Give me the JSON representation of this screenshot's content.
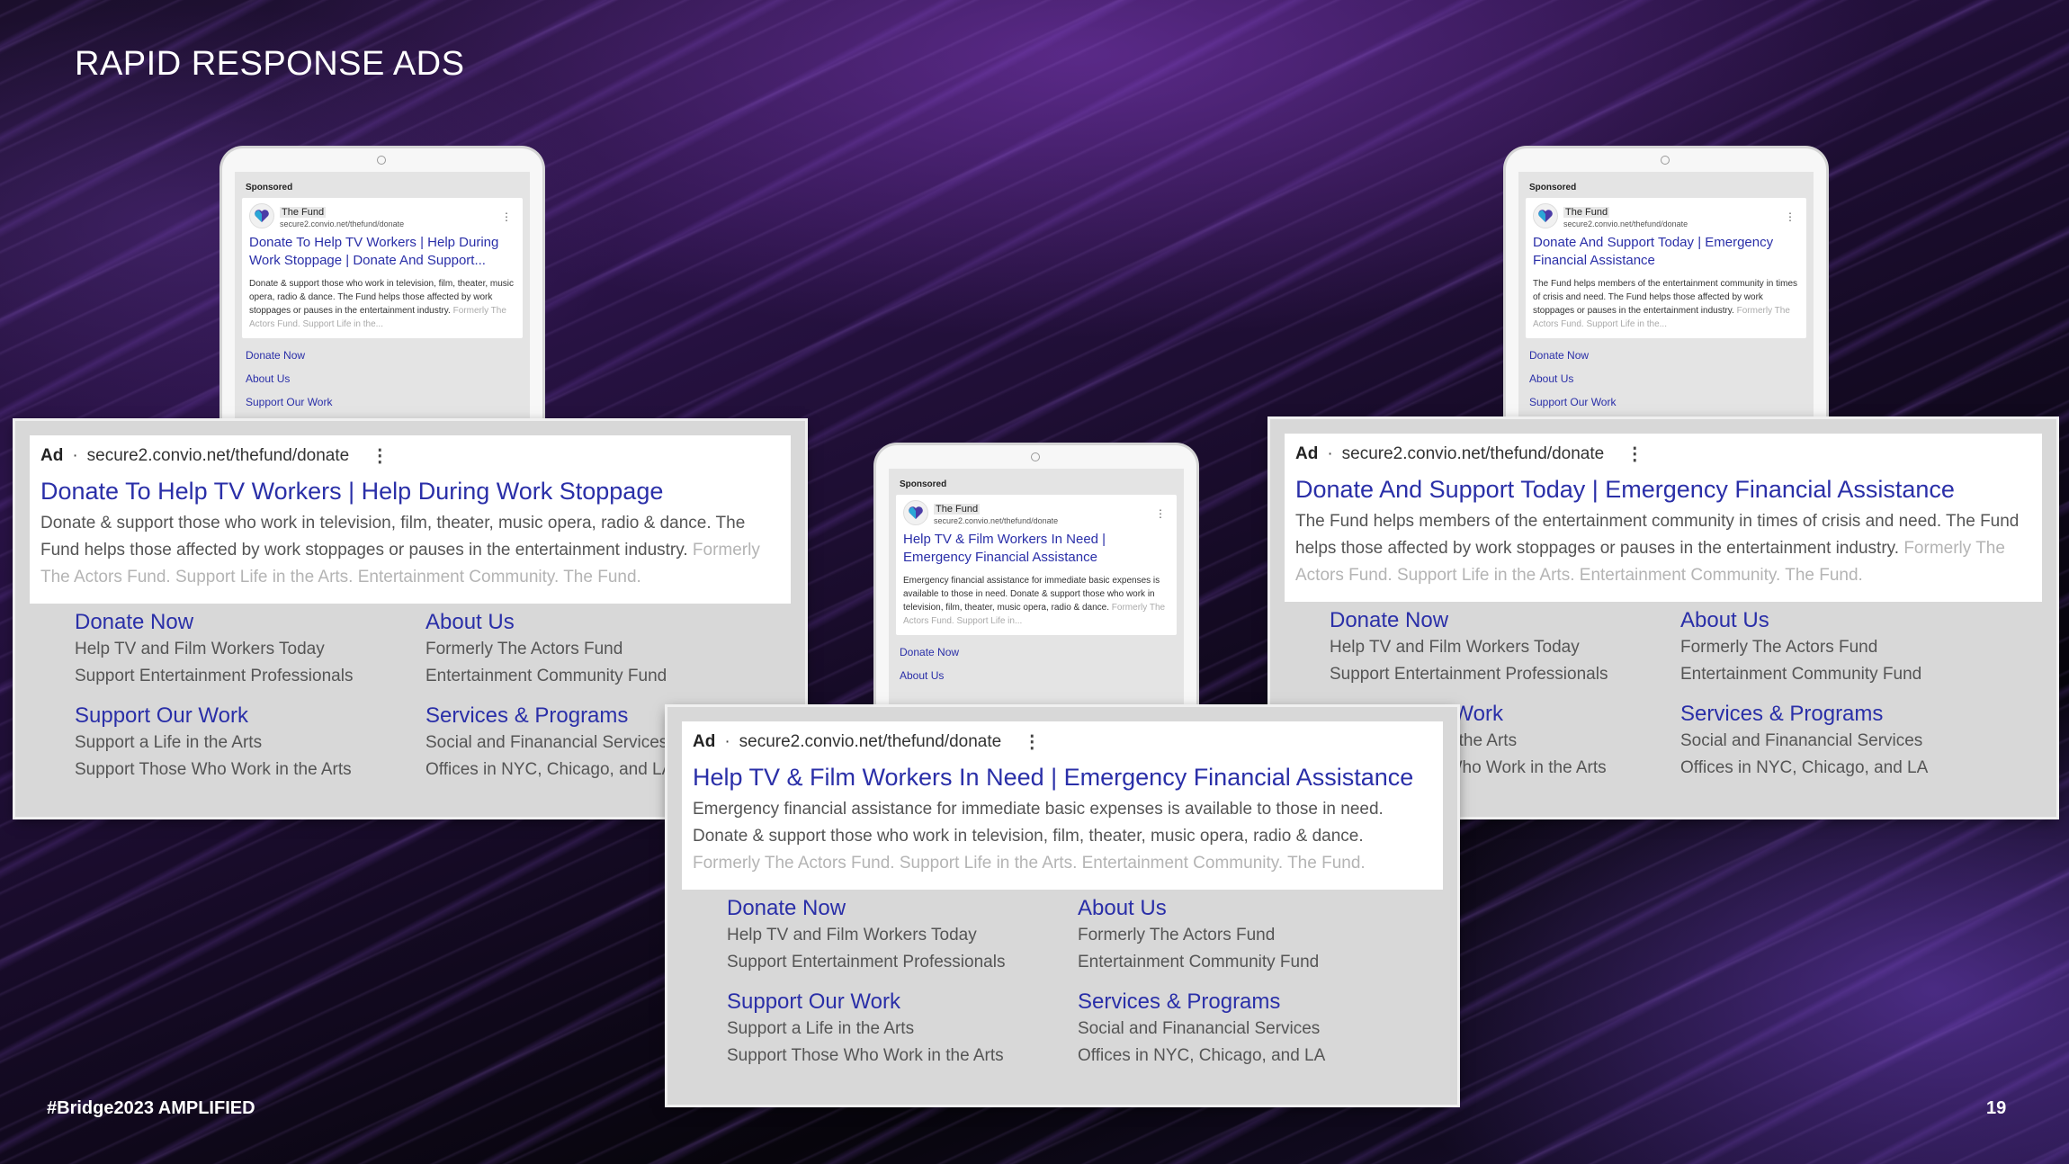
{
  "slide": {
    "title": "RAPID RESPONSE ADS",
    "footer": "#Bridge2023 AMPLIFIED",
    "page_number": "19"
  },
  "colors": {
    "link": "#2a2fa8",
    "text": "#555555",
    "faded": "#b4b4b4"
  },
  "phones": [
    {
      "sponsored": "Sponsored",
      "brand": "The Fund",
      "url": "secure2.convio.net/thefund/donate",
      "headline": "Donate To Help TV Workers | Help During Work Stoppage | Donate And Support...",
      "desc": "Donate & support those who work in television, film, theater, music opera, radio & dance. The Fund helps those affected by work stoppages or pauses in the entertainment industry.",
      "desc_faded": "Formerly The Actors Fund. Support Life in the...",
      "sitelinks": [
        "Donate Now",
        "About Us",
        "Support Our Work"
      ]
    },
    {
      "sponsored": "Sponsored",
      "brand": "The Fund",
      "url": "secure2.convio.net/thefund/donate",
      "headline": "Help TV & Film Workers In Need | Emergency Financial Assistance",
      "desc": "Emergency financial assistance for immediate basic expenses is available to those in need. Donate & support those who work in television, film, theater, music opera, radio & dance.",
      "desc_faded": "Formerly The Actors Fund. Support Life in...",
      "sitelinks": [
        "Donate Now",
        "About Us"
      ]
    },
    {
      "sponsored": "Sponsored",
      "brand": "The Fund",
      "url": "secure2.convio.net/thefund/donate",
      "headline": "Donate And Support Today | Emergency Financial Assistance",
      "desc": "The Fund helps members of the entertainment community in times of crisis and need. The Fund helps those affected by work stoppages or pauses in the entertainment industry.",
      "desc_faded": "Formerly The Actors Fund. Support Life in the...",
      "sitelinks": [
        "Donate Now",
        "About Us",
        "Support Our Work"
      ]
    }
  ],
  "ads": [
    {
      "label": "Ad",
      "url": "secure2.convio.net/thefund/donate",
      "headline": "Donate To Help TV Workers | Help During Work Stoppage",
      "desc": "Donate & support those who work in television, film, theater, music opera, radio & dance. The Fund helps those affected by work stoppages or pauses in the entertainment industry.",
      "desc_faded": "Formerly The Actors Fund. Support Life in the Arts. Entertainment Community. The Fund.",
      "sitelinks": [
        {
          "title": "Donate Now",
          "line1": "Help TV and Film Workers Today",
          "line2": "Support Entertainment Professionals"
        },
        {
          "title": "About Us",
          "line1": "Formerly The Actors Fund",
          "line2": "Entertainment Community Fund"
        },
        {
          "title": "Support Our Work",
          "line1": "Support a Life in the Arts",
          "line2": "Support Those Who Work in the Arts"
        },
        {
          "title": "Services & Programs",
          "line1": "Social and Finanancial Services",
          "line2": "Offices in NYC, Chicago, and LA"
        }
      ]
    },
    {
      "label": "Ad",
      "url": "secure2.convio.net/thefund/donate",
      "headline": "Donate And Support Today | Emergency Financial Assistance",
      "desc": "The Fund helps members of the entertainment community in times of crisis and need. The Fund helps those affected by work stoppages or pauses in the entertainment industry.",
      "desc_faded": "Formerly The Actors Fund. Support Life in the Arts. Entertainment Community. The Fund.",
      "sitelinks": [
        {
          "title": "Donate Now",
          "line1": "Help TV and Film Workers Today",
          "line2": "Support Entertainment Professionals"
        },
        {
          "title": "About Us",
          "line1": "Formerly The Actors Fund",
          "line2": "Entertainment Community Fund"
        },
        {
          "title": "Support Our Work",
          "line1": "Support a Life in the Arts",
          "line2": "Support Those Who Work in the Arts"
        },
        {
          "title": "Services & Programs",
          "line1": "Social and Finanancial Services",
          "line2": "Offices in NYC, Chicago, and LA"
        }
      ]
    },
    {
      "label": "Ad",
      "url": "secure2.convio.net/thefund/donate",
      "headline": "Help TV & Film Workers In Need | Emergency Financial Assistance",
      "desc": "Emergency financial assistance for immediate basic expenses is available to those in need. Donate & support those who work in television, film, theater, music opera, radio & dance.",
      "desc_faded": "Formerly The Actors Fund. Support Life in the Arts. Entertainment Community. The Fund.",
      "sitelinks": [
        {
          "title": "Donate Now",
          "line1": "Help TV and Film Workers Today",
          "line2": "Support Entertainment Professionals"
        },
        {
          "title": "About Us",
          "line1": "Formerly The Actors Fund",
          "line2": "Entertainment Community Fund"
        },
        {
          "title": "Support Our Work",
          "line1": "Support a Life in the Arts",
          "line2": "Support Those Who Work in the Arts"
        },
        {
          "title": "Services & Programs",
          "line1": "Social and Finanancial Services",
          "line2": "Offices in NYC, Chicago, and LA"
        }
      ]
    }
  ]
}
